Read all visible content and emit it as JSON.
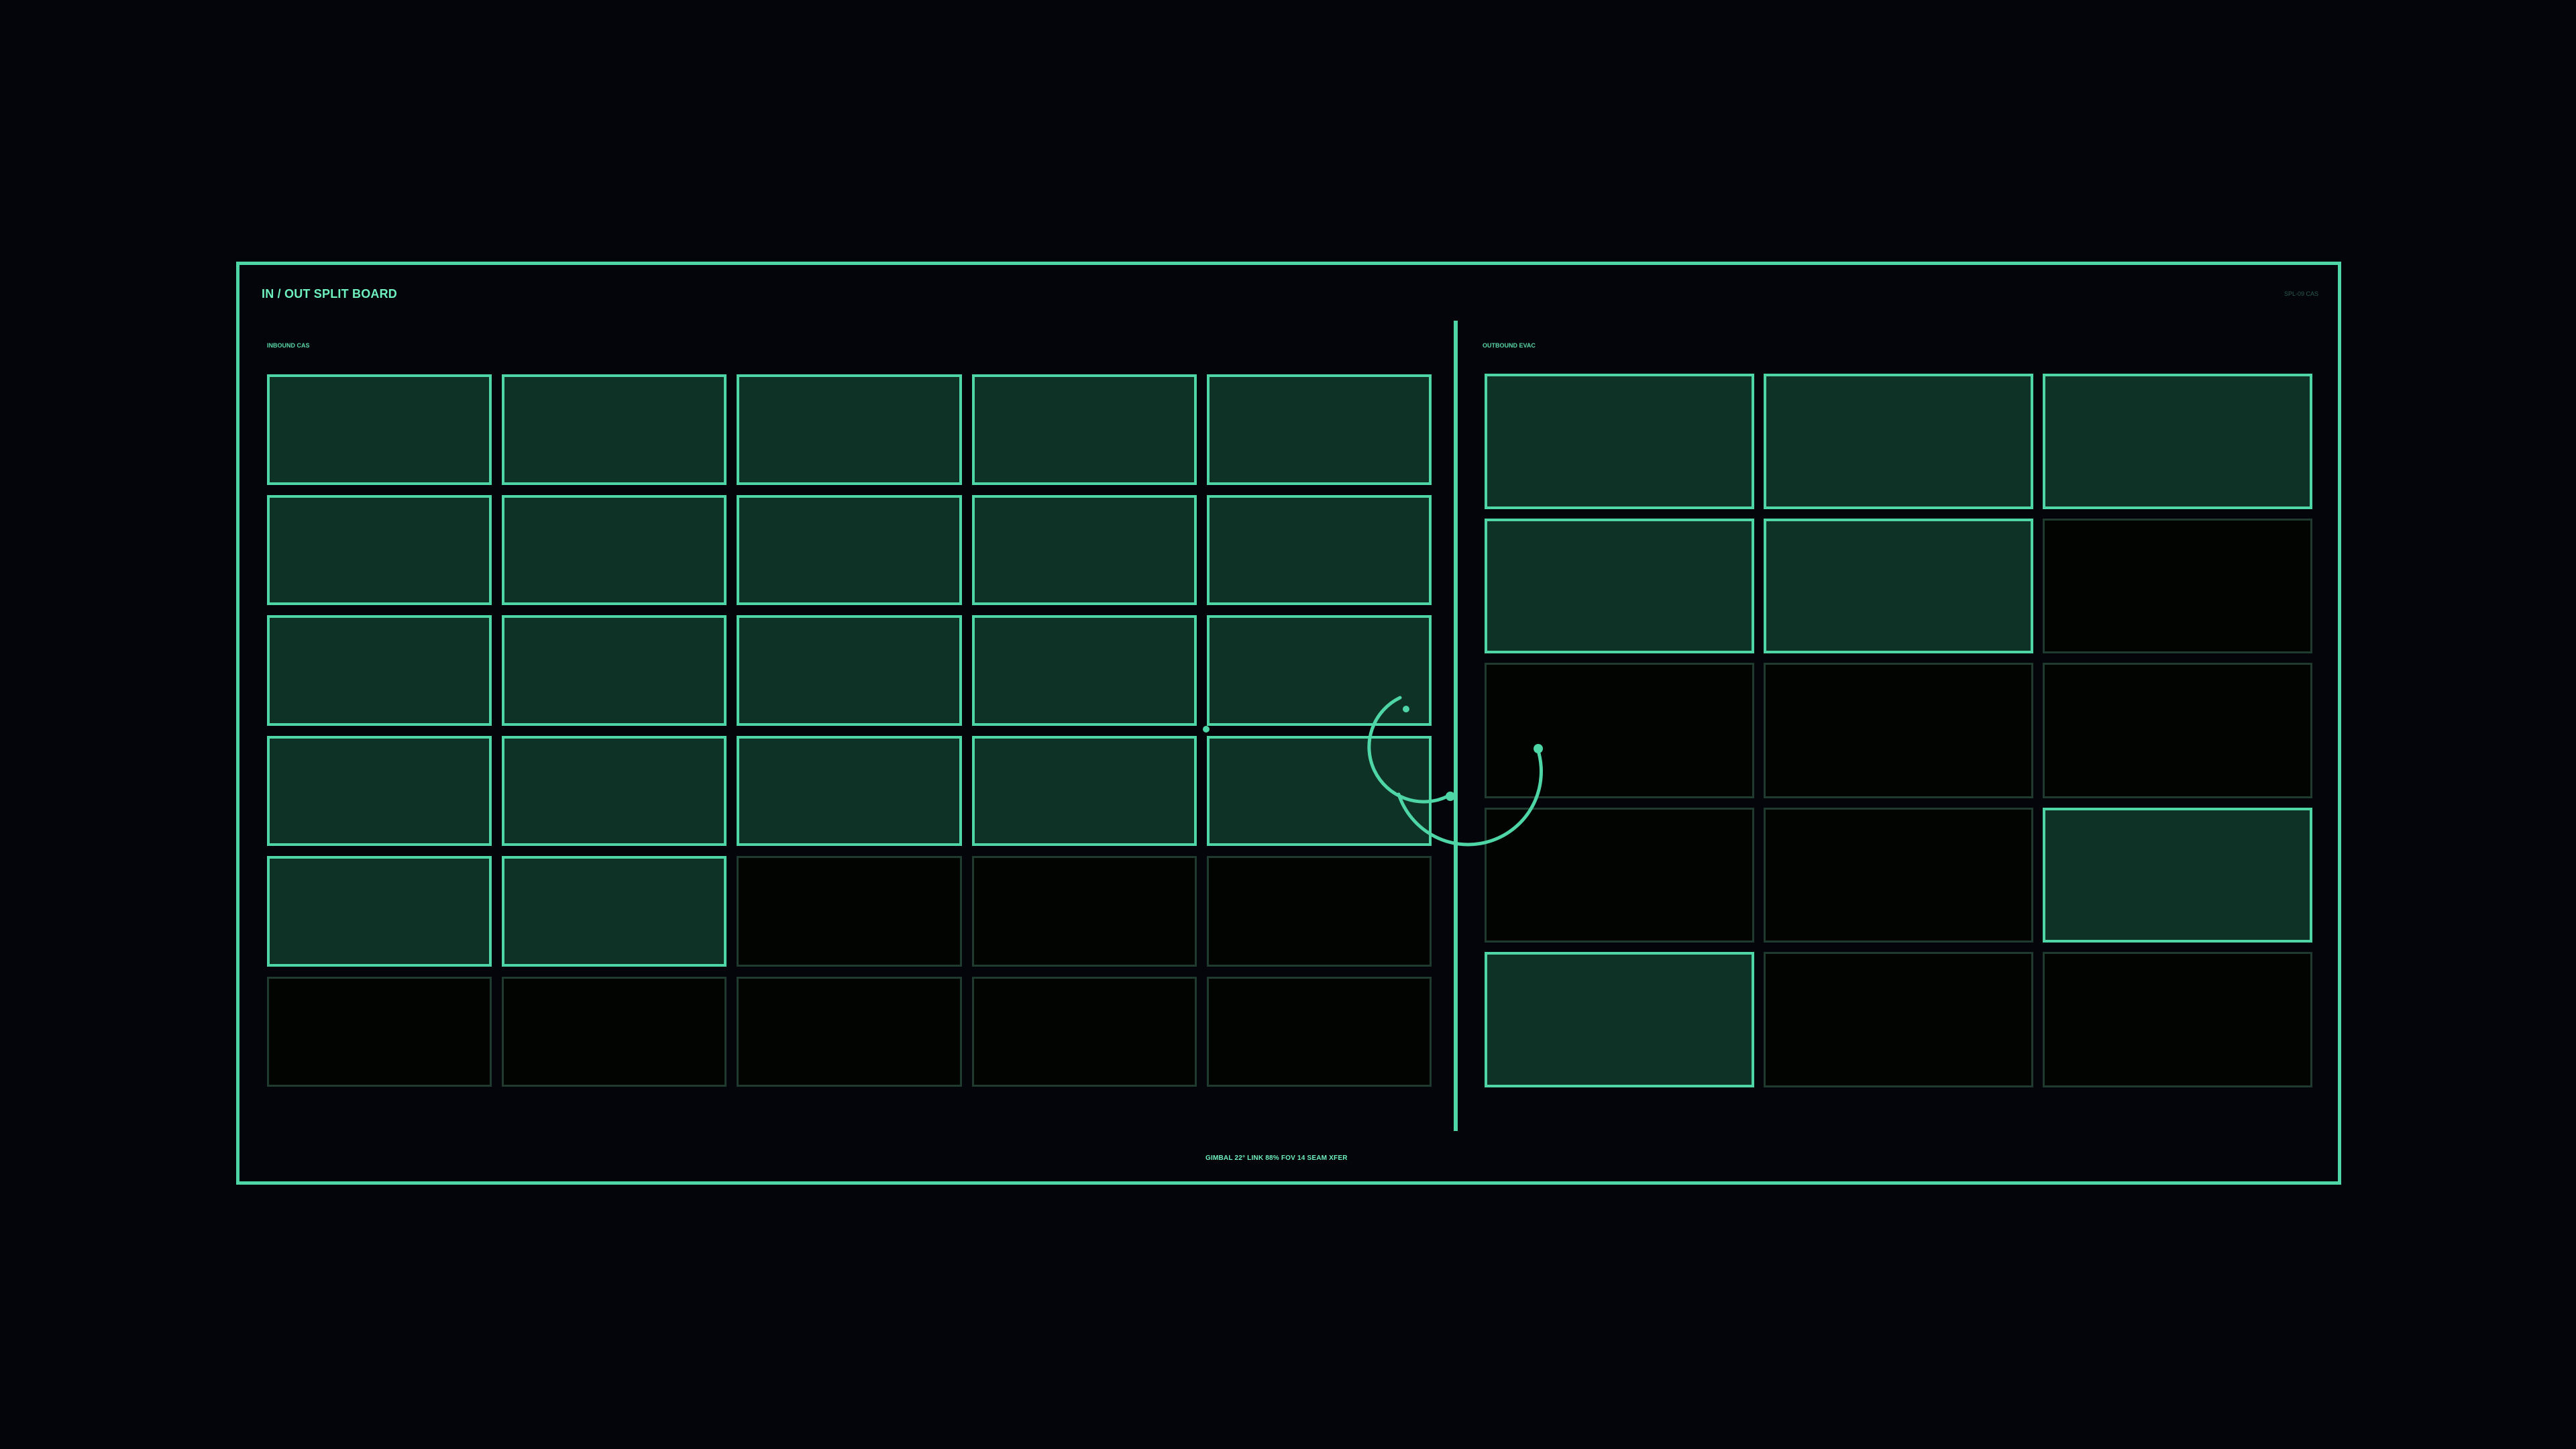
{
  "window": {
    "title": "IN / OUT SPLIT BOARD",
    "tag": "SPL-09 CAS"
  },
  "inbound": {
    "label": "INBOUND CAS",
    "columns": 5,
    "rows": 6,
    "filled_count": 22,
    "total_slots": 30
  },
  "outbound": {
    "label": "OUTBOUND EVAC",
    "columns": 3,
    "rows": 5,
    "filled_slots": [
      1,
      2,
      3,
      4,
      5,
      12,
      13
    ],
    "total_slots": 15
  },
  "footer": {
    "status": "GIMBAL 22°  LINK 88%  FOV 14  SEAM XFER"
  },
  "colors": {
    "accent": "#4fd6a6",
    "fill": "#0f3227",
    "empty": "#020402",
    "background": "#03050a"
  },
  "icons": {
    "transfer": "seam-transfer-arc-icon"
  }
}
